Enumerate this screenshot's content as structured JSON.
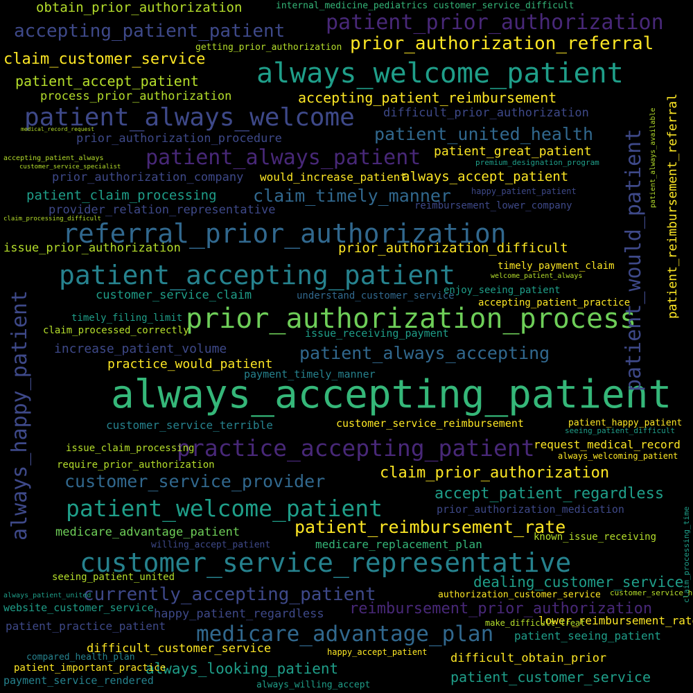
{
  "palette": {
    "background": "#000000",
    "yellow": "#fde725",
    "lime": "#b5de2b",
    "green": "#6ece58",
    "teal_green": "#35b779",
    "teal": "#1f9e89",
    "blue_teal": "#26828e",
    "steel_blue": "#31688e",
    "indigo": "#3e4989",
    "purple": "#482878",
    "dark_purple": "#440154"
  },
  "words": [
    "always_accepting_patient",
    "customer_service_representative",
    "always_welcome_patient",
    "prior_authorization_process",
    "referral_prior_authorization",
    "patient_accepting_patient",
    "patient_always_welcome",
    "patient_prior_authorization",
    "always_happy_patient",
    "patient_would_patient",
    "practice_accepting_patient",
    "patient_welcome_patient",
    "medicare_advantage_plan",
    "accepting_patient_patient",
    "patient_always_patient",
    "prior_authorization_referral",
    "currently_accepting_patient",
    "customer_service_provider",
    "patient_reimbursement_rate",
    "patient_always_accepting",
    "patient_united_health",
    "claim_prior_authorization",
    "accept_patient_regardless",
    "reimbursement_prior_authorization",
    "claim_customer_service",
    "patient_accept_patient",
    "obtain_prior_authorization",
    "claim_timely_manner",
    "patient_claim_processing",
    "always_accept_patient",
    "accepting_patient_reimbursement",
    "patient_reimbursement_referral",
    "prior_authorization_difficult",
    "patient_great_patient",
    "dealing_customer_service",
    "always_looking_patient",
    "patient_customer_service",
    "difficult_customer_service",
    "difficult_obtain_prior",
    "increase_patient_volume",
    "practice_would_patient",
    "customer_service_claim",
    "difficult_prior_authorization",
    "medicare_advantage_patient",
    "prior_authorization_procedure",
    "process_prior_authorization",
    "prior_authorization_company",
    "provider_relation_representative",
    "issue_prior_authorization",
    "would_increase_patient",
    "happy_patient_regardless",
    "patient_seeing_patient",
    "website_customer_service",
    "patient_practice_patient",
    "customer_service_terrible",
    "request_medical_record",
    "medicare_replacement_plan",
    "lower_reimbursement_rate",
    "timely_payment_claim",
    "enjoy_seeing_patient",
    "timely_filing_limit",
    "issue_receiving_payment",
    "payment_timely_manner",
    "understand_customer_service",
    "customer_service_reimbursement",
    "require_prior_authorization",
    "issue_claim_processing",
    "known_issue_receiving",
    "seeing_patient_united",
    "prior_authorization_medication",
    "accepting_patient_practice",
    "always_welcoming_patient",
    "authorization_customer_service",
    "getting_prior_authorization",
    "internal_medicine_pediatrics",
    "patient_happy_patient",
    "claim_processed_correctly",
    "compared_health_plan",
    "payment_service_rendered",
    "patient_important_practice",
    "always_willing_accept",
    "happy_accept_patient",
    "willing_accept_patient",
    "make_difficult_treat",
    "reimbursement_lower_company",
    "happy_patient_patient",
    "medical_record_request",
    "claim_processing_difficult",
    "customer_service_difficult",
    "accepting_patient_always",
    "customer_service_specialist",
    "welcome_patient_always",
    "premium_designation_program",
    "seeing_patient_difficult",
    "patient_always_available",
    "customer_service_helpful",
    "always_patient_united",
    "claim_processing_time"
  ]
}
